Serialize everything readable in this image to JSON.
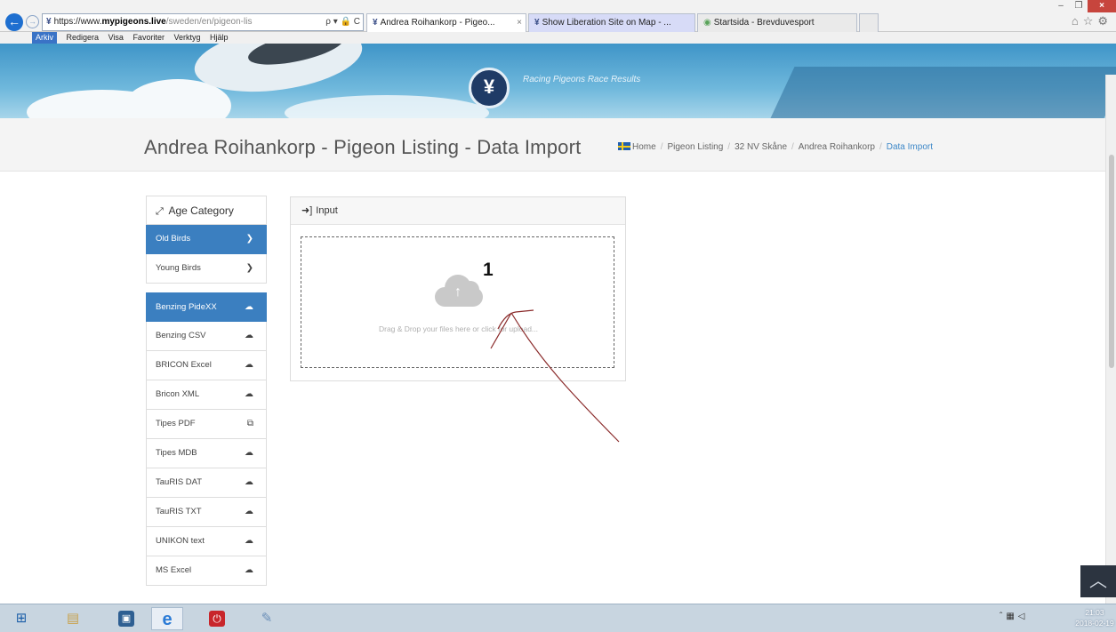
{
  "browser": {
    "address": {
      "prefix": "https://www.",
      "domain": "mypigeons.live",
      "path": "/sweden/en/pigeon-lis",
      "actions": "ρ ▾ 🔒 C"
    },
    "tabs": [
      {
        "label": "Andrea Roihankorp - Pigeo...",
        "close": "×"
      },
      {
        "label": "Show Liberation Site on Map - ..."
      },
      {
        "label": "Startsida - Brevduvesport"
      }
    ],
    "menu": [
      "Arkiv",
      "Redigera",
      "Visa",
      "Favoriter",
      "Verktyg",
      "Hjälp"
    ]
  },
  "banner": {
    "tagline": "Racing Pigeons Race Results"
  },
  "page": {
    "title": "Andrea Roihankorp - Pigeon Listing - Data Import",
    "breadcrumb": [
      "Home",
      "Pigeon Listing",
      "32 NV Skåne",
      "Andrea Roihankorp",
      "Data Import"
    ],
    "breadcrumb_sep": "/"
  },
  "sidebar": {
    "heading": "Age Category",
    "age_items": [
      {
        "label": "Old Birds",
        "active": true
      },
      {
        "label": "Young Birds",
        "active": false
      }
    ],
    "formats": [
      {
        "label": "Benzing PideXX",
        "active": true
      },
      {
        "label": "Benzing CSV"
      },
      {
        "label": "BRICON Excel"
      },
      {
        "label": "Bricon XML"
      },
      {
        "label": "Tipes PDF"
      },
      {
        "label": "Tipes MDB"
      },
      {
        "label": "TauRIS DAT"
      },
      {
        "label": "TauRIS TXT"
      },
      {
        "label": "UNIKON text"
      },
      {
        "label": "MS Excel"
      }
    ]
  },
  "input_panel": {
    "heading": "Input",
    "dropzone_text": "Drag & Drop your files here or click for upload..."
  },
  "annotation": {
    "number": "1"
  },
  "taskbar": {
    "time": "21:03",
    "date": "2018-02-19"
  },
  "colors": {
    "accent": "#3b7fc0",
    "breadcrumb_active": "#3e88c8",
    "annotation_line": "#8a2a2a"
  }
}
